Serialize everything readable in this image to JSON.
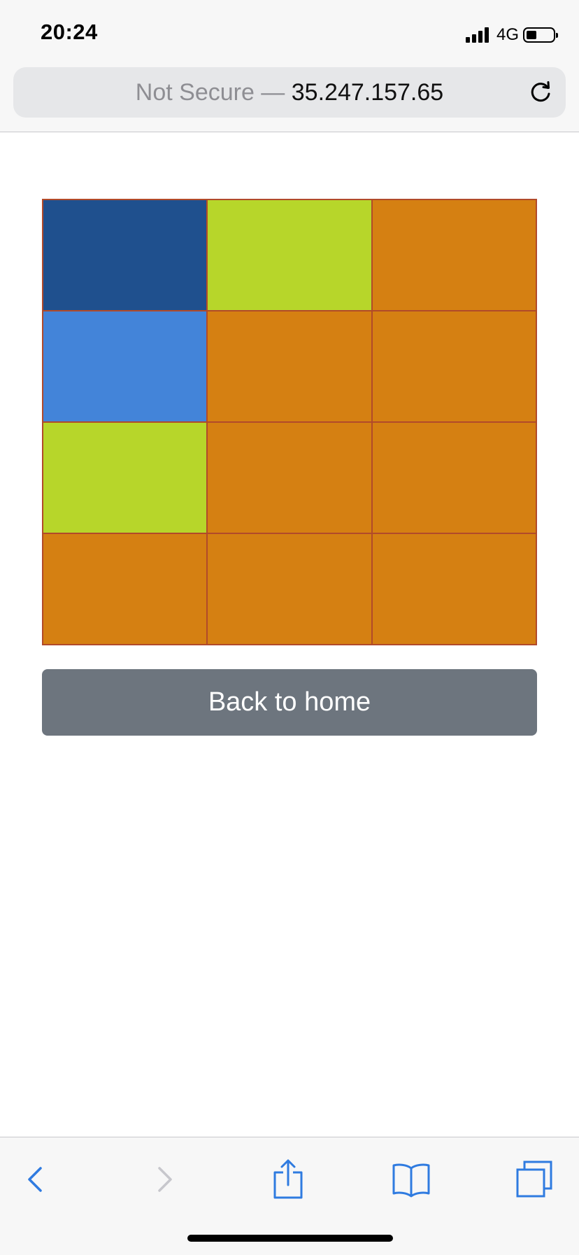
{
  "status_bar": {
    "time": "20:24",
    "network": "4G"
  },
  "address_bar": {
    "prefix": "Not Secure — ",
    "host": "35.247.157.65"
  },
  "grid": {
    "rows": 4,
    "columns": 3,
    "cells": [
      "#1f508e",
      "#b7d62a",
      "#d58012",
      "#4384d9",
      "#d58012",
      "#d58012",
      "#b7d62a",
      "#d58012",
      "#d58012",
      "#d58012",
      "#d58012",
      "#d58012"
    ],
    "border_color": "#b14a2a"
  },
  "back_button": {
    "label": "Back to home"
  },
  "toolbar": {
    "items": [
      "back-icon",
      "forward-icon",
      "share-icon",
      "bookmarks-icon",
      "tabs-icon"
    ],
    "accent_color": "#2f7be0",
    "disabled_color": "#c7c7cc"
  }
}
